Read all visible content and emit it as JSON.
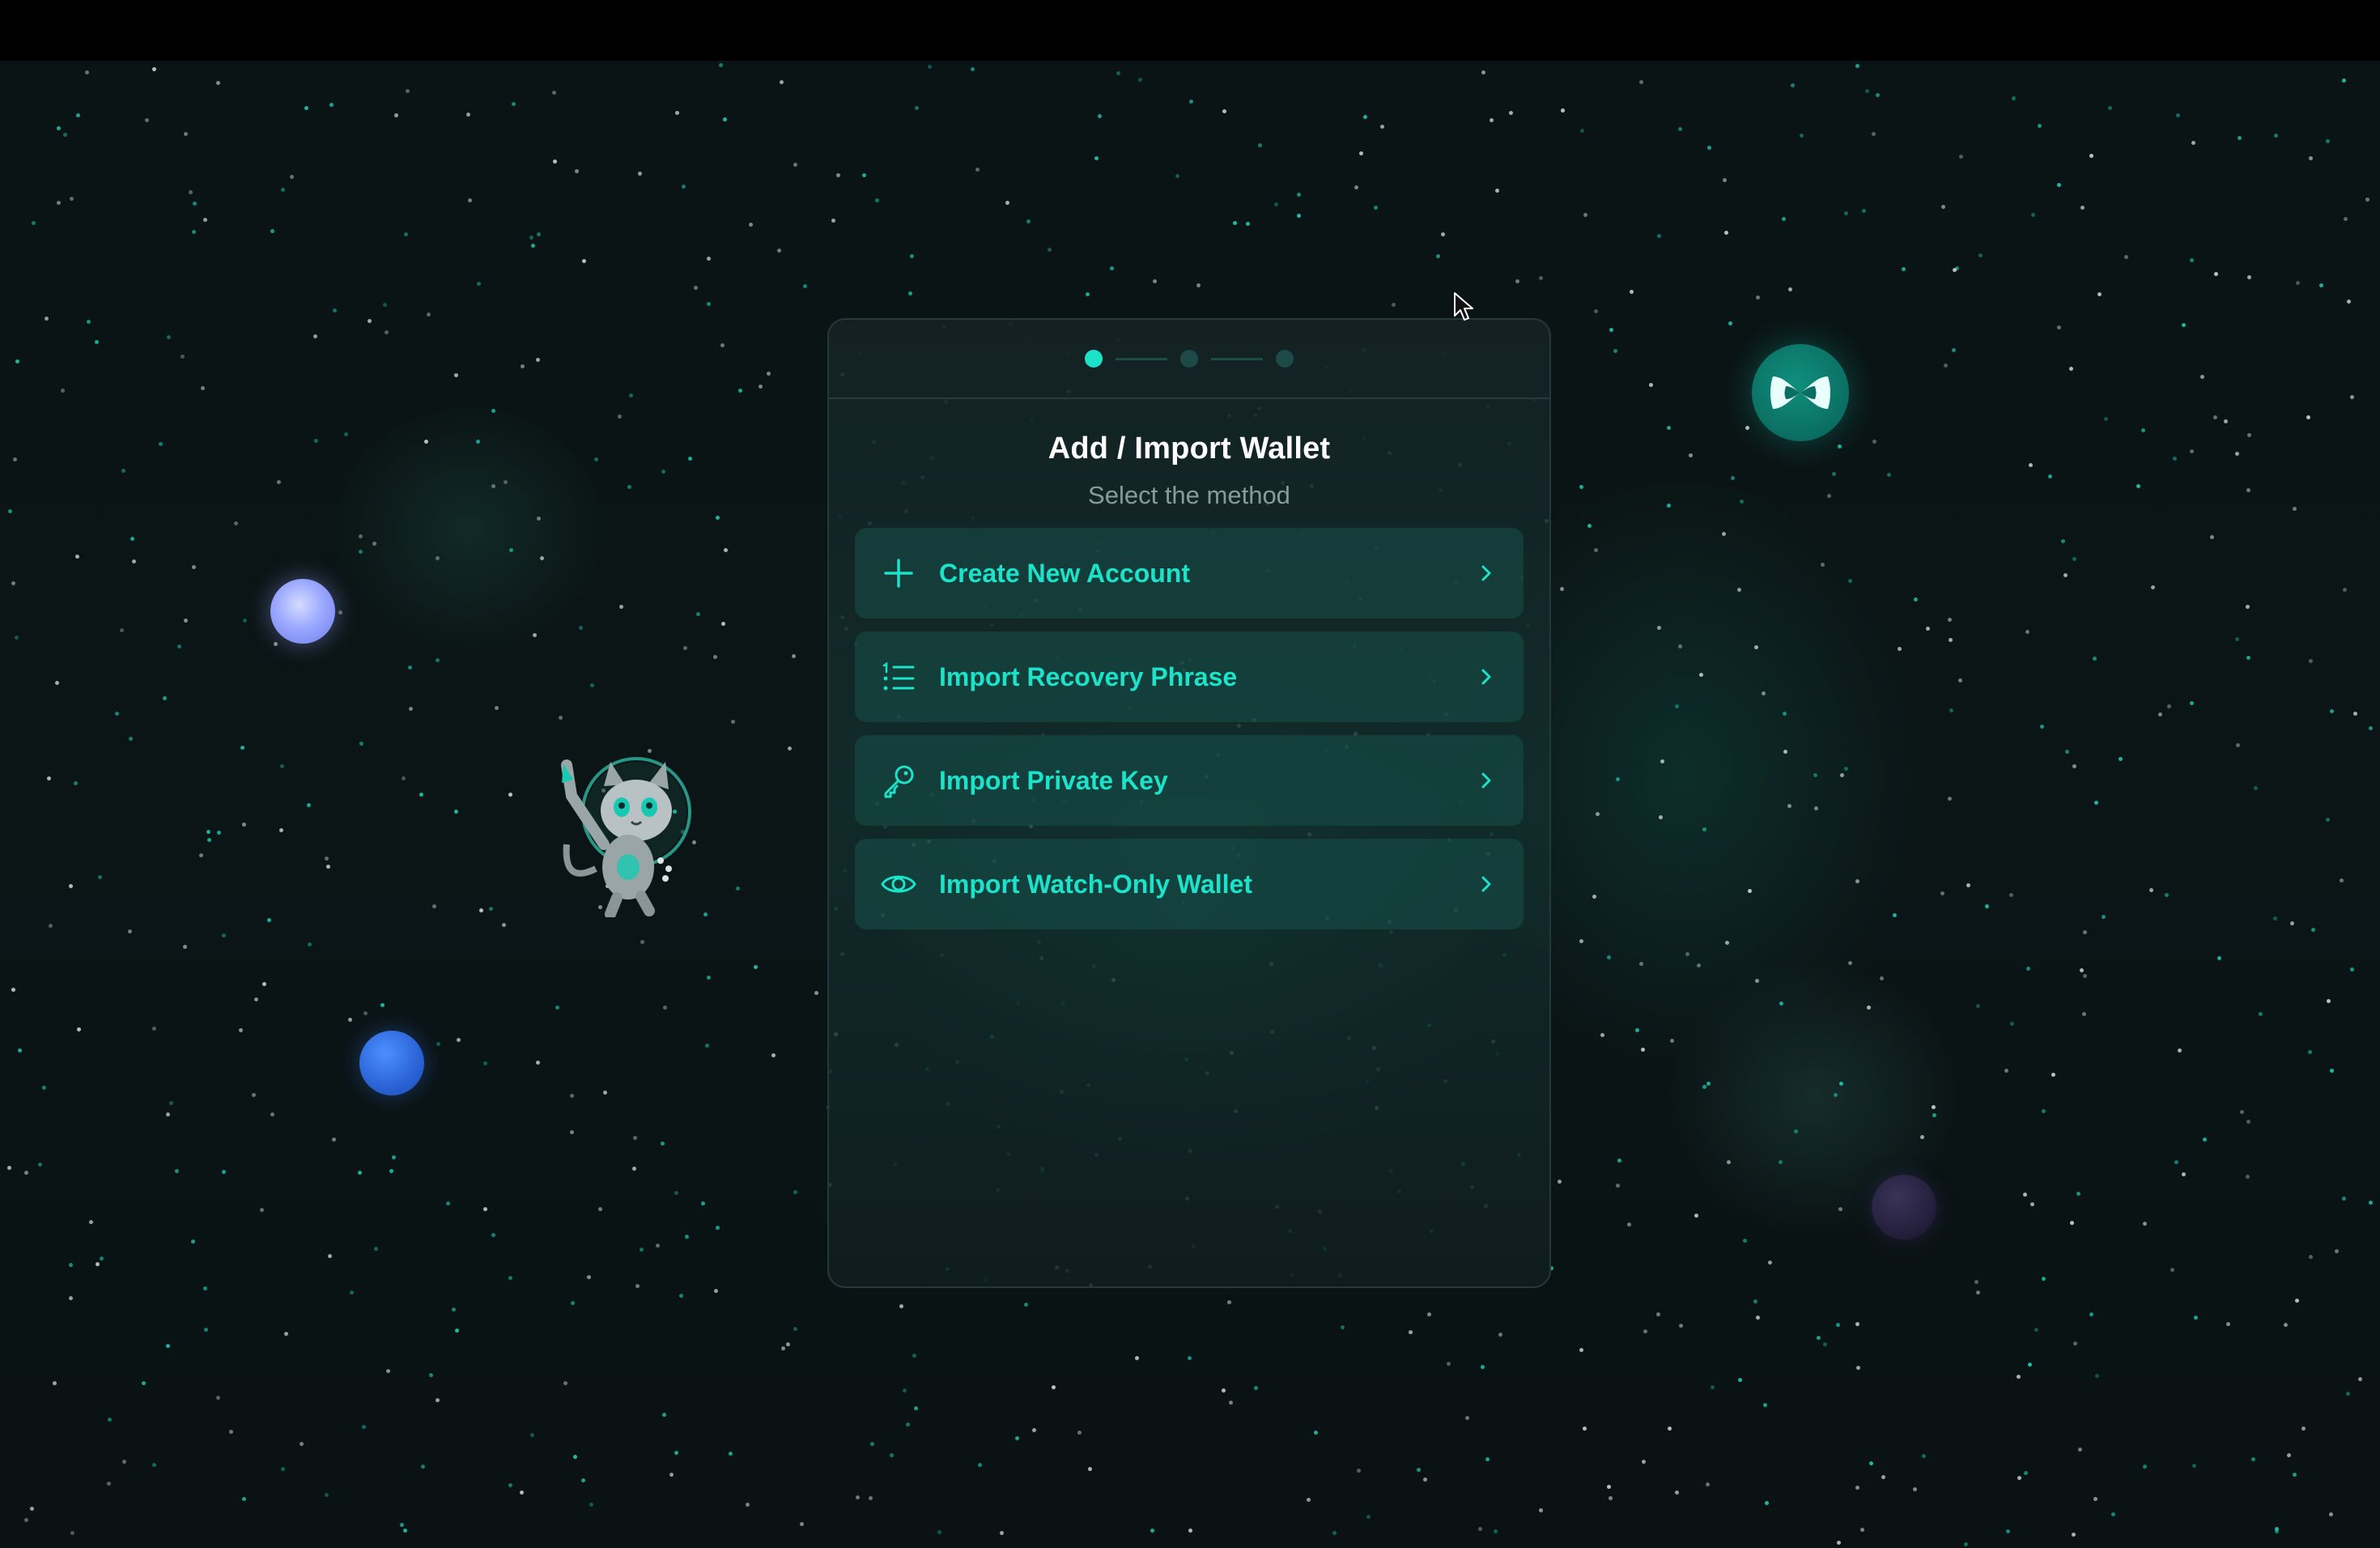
{
  "stepper": {
    "total_steps": 3,
    "current_step": 1
  },
  "dialog": {
    "title": "Add / Import Wallet",
    "subtitle": "Select the method"
  },
  "options": [
    {
      "label": "Create New Account",
      "icon": "plus-icon"
    },
    {
      "label": "Import Recovery Phrase",
      "icon": "numbered-list-icon"
    },
    {
      "label": "Import Private Key",
      "icon": "key-icon"
    },
    {
      "label": "Import Watch-Only Wallet",
      "icon": "eye-icon"
    }
  ],
  "colors": {
    "accent": "#1ce2c9",
    "background": "#0a1414",
    "panel_border": "#28383a",
    "subtitle": "#8a9a9c"
  }
}
